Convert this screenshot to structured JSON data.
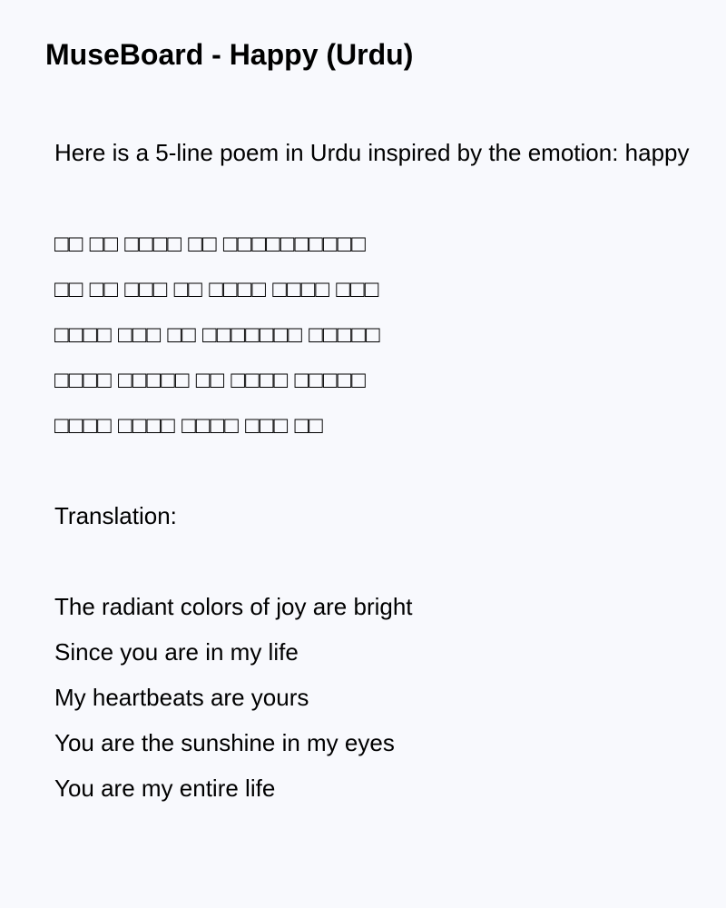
{
  "header": {
    "title": "MuseBoard - Happy (Urdu)"
  },
  "poem": {
    "intro": "Here is a 5-line poem in Urdu inspired by the emotion: happy",
    "urdu_lines": [
      "□□ □□ □□□□ □□ □□□□□□□□□□",
      "□□ □□ □□□ □□ □□□□ □□□□ □□□",
      "□□□□ □□□ □□ □□□□□□□ □□□□□",
      "□□□□ □□□□□ □□ □□□□ □□□□□",
      "□□□□ □□□□ □□□□ □□□ □□"
    ],
    "translation_label": "Translation:",
    "translation_lines": [
      "The radiant colors of joy are bright",
      "Since you are in my life",
      "My heartbeats are yours",
      "You are the sunshine in my eyes",
      "You are my entire life"
    ]
  },
  "colors": {
    "background": "#f8f9fd",
    "text": "#000000"
  }
}
